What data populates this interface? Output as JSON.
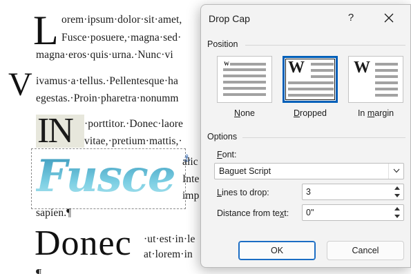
{
  "document": {
    "drop_L": "L",
    "line1": "orem·ipsum·dolor·sit·amet,",
    "line2": "Fusce·posuere,·magna·sed·",
    "line3": "magna·eros·quis·urna.·Nunc·vi",
    "margin_V": "V",
    "line4": "ivamus·a·tellus.·Pellentesque·ha",
    "line5": "egestas.·Proin·pharetra·nonumm",
    "drop_IN": "IN",
    "line6": "·porttitor.·Donec·laore",
    "line7": "vitae,·pretium·mattis,·",
    "wordart": "Fusce",
    "line8": "alic",
    "line9": "Inte",
    "line10": "imp",
    "line11": "sapien.¶",
    "big_donec": "Donec",
    "line12": "·ut·est·in·le",
    "line13": "at·lorem·in",
    "bottom_pilcrow": "¶"
  },
  "dialog": {
    "title": "Drop Cap",
    "help": "?",
    "position_label": "Position",
    "positions": [
      {
        "label_pre": "",
        "label_u": "N",
        "label_post": "one",
        "glyph": "W"
      },
      {
        "label_pre": "",
        "label_u": "D",
        "label_post": "ropped",
        "glyph": "W"
      },
      {
        "label_pre": "In ",
        "label_u": "m",
        "label_post": "argin",
        "glyph": "W"
      }
    ],
    "options_label": "Options",
    "font_label_u": "F",
    "font_label_rest": "ont:",
    "font_value": "Baguet Script",
    "lines_label_pre": "",
    "lines_label_u": "L",
    "lines_label_rest": "ines to drop:",
    "lines_value": "3",
    "distance_label_pre": "Distance from te",
    "distance_label_u": "x",
    "distance_label_rest": "t:",
    "distance_value": "0\"",
    "ok_label": "OK",
    "cancel_label": "Cancel",
    "selected_position": "Dropped",
    "accent_color": "#005fb8"
  }
}
